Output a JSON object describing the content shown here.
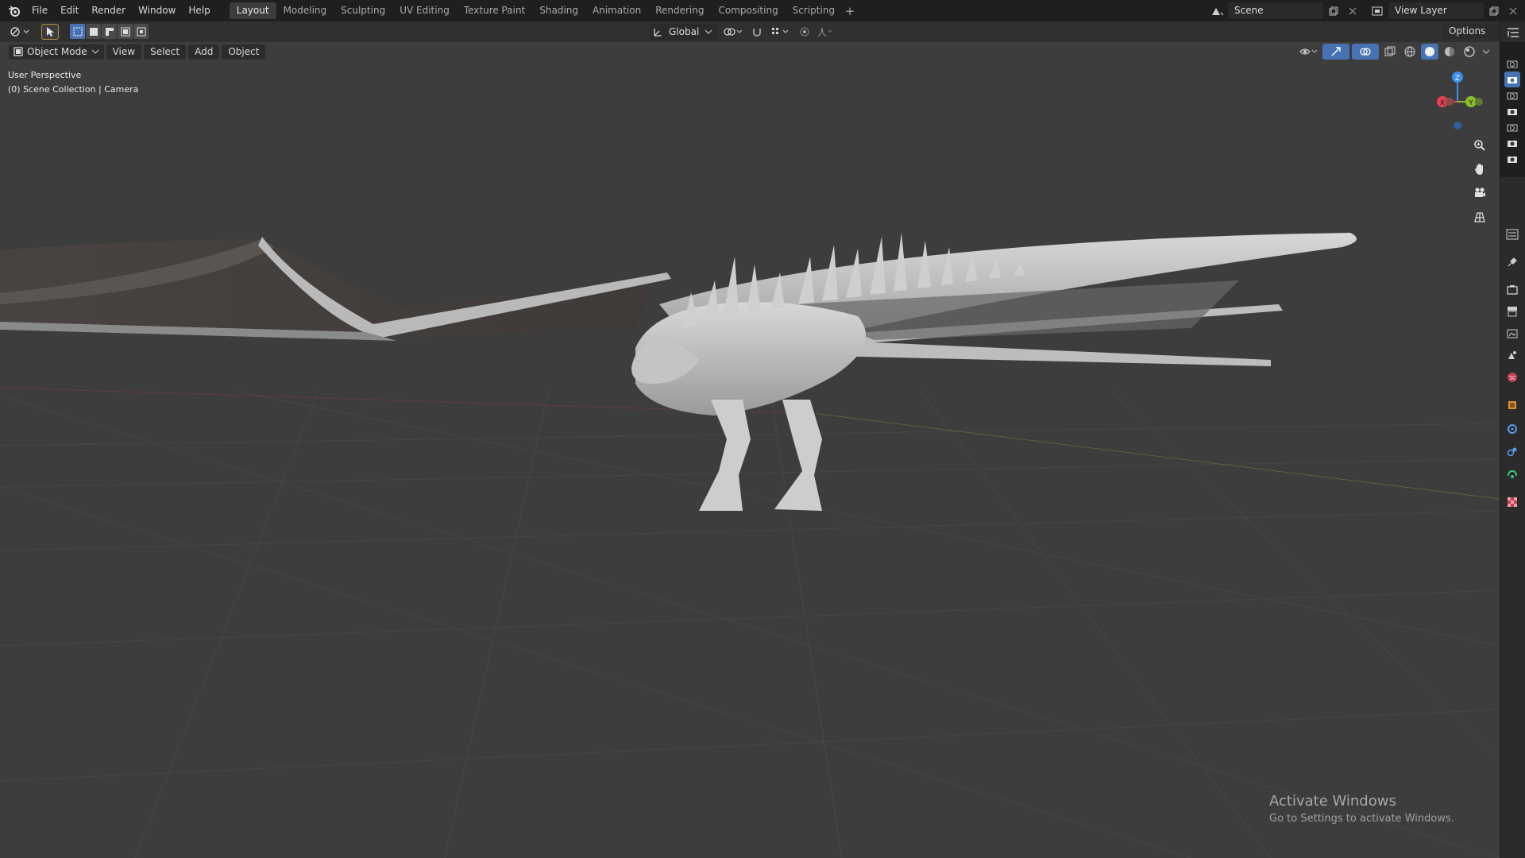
{
  "menubar": {
    "items": [
      "File",
      "Edit",
      "Render",
      "Window",
      "Help"
    ],
    "workspaces": [
      "Layout",
      "Modeling",
      "Sculpting",
      "UV Editing",
      "Texture Paint",
      "Shading",
      "Animation",
      "Rendering",
      "Compositing",
      "Scripting"
    ],
    "active_workspace": "Layout",
    "scene": "Scene",
    "view_layer": "View Layer"
  },
  "toolbar": {
    "transform_orientation": "Global",
    "options_label": "Options"
  },
  "viewport_header": {
    "mode": "Object Mode",
    "menus": [
      "View",
      "Select",
      "Add",
      "Object"
    ]
  },
  "viewport": {
    "perspective": "User Perspective",
    "collection_info": "(0) Scene Collection | Camera",
    "gizmo_axes": {
      "z": "Z",
      "y": "Y",
      "x": "X"
    }
  },
  "watermark": {
    "title": "Activate Windows",
    "subtitle": "Go to Settings to activate Windows."
  },
  "colors": {
    "header": "#1f1f1f",
    "toolbar": "#303030",
    "viewport": "#3d3d3d",
    "accent": "#4772b3",
    "axis_x": "#e8404f",
    "axis_y": "#8bbd2c",
    "axis_z": "#3c8cf0"
  }
}
